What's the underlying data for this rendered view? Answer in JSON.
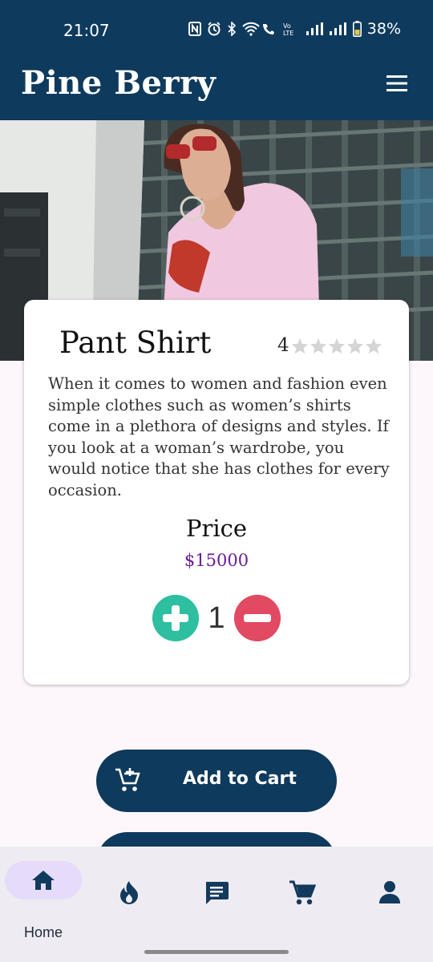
{
  "status_bar": {
    "time": "21:07",
    "battery": "38%",
    "icons": [
      "nfc-icon",
      "alarm-icon",
      "bluetooth-icon",
      "wifi-call-icon",
      "volte-icon",
      "signal-icon",
      "signal-icon",
      "battery-icon"
    ]
  },
  "app": {
    "brand": "Pine Berry",
    "menu_icon": "hamburger-menu-icon"
  },
  "product": {
    "title": "Pant Shirt",
    "rating": "4",
    "rating_value": 0,
    "rating_max": 5,
    "description": "When it comes to women and fashion even simple clothes such as women’s shirts come in a plethora of designs and styles. If you look at a woman’s wardrobe, you would notice that she has clothes for every occasion.",
    "price_label": "Price",
    "price": "$15000",
    "quantity": "1"
  },
  "actions": {
    "add_to_cart": "Add to Cart"
  },
  "bottom_nav": {
    "items": [
      {
        "icon": "home-icon",
        "label": "Home",
        "active": true
      },
      {
        "icon": "fire-icon",
        "label": ""
      },
      {
        "icon": "chat-icon",
        "label": ""
      },
      {
        "icon": "cart-icon",
        "label": ""
      },
      {
        "icon": "profile-icon",
        "label": ""
      }
    ]
  },
  "colors": {
    "primary": "#0e3a5d",
    "plus": "#2dbf9f",
    "minus": "#e14a62",
    "price": "#6a1b9a",
    "nav_active": "#e6dcfa"
  }
}
